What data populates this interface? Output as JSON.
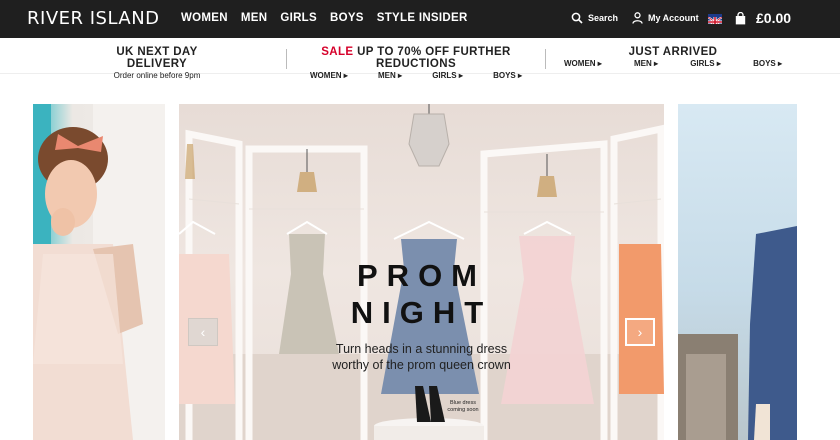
{
  "brand": {
    "logo_text": "RIVER ISLAND"
  },
  "nav": {
    "items": [
      {
        "label": "WOMEN"
      },
      {
        "label": "MEN"
      },
      {
        "label": "GIRLS"
      },
      {
        "label": "BOYS"
      },
      {
        "label": "STYLE INSIDER"
      }
    ]
  },
  "utility": {
    "search_label": "Search",
    "account_label": "My Account",
    "bag_total": "£0.00",
    "search_icon": "search-icon",
    "account_icon": "user-icon",
    "bag_icon": "bag-icon",
    "flag_icon": "uk-flag-icon"
  },
  "promos": {
    "delivery": {
      "title": "UK NEXT DAY DELIVERY",
      "subtitle": "Order online before 9pm"
    },
    "sale": {
      "title_highlight": "SALE",
      "title_rest": " UP TO 70% OFF FURTHER REDUCTIONS",
      "links": [
        "WOMEN ▸",
        "MEN ▸",
        "GIRLS ▸",
        "BOYS ▸"
      ]
    },
    "arrived": {
      "title": "JUST ARRIVED",
      "links": [
        "WOMEN ▸",
        "MEN ▸",
        "GIRLS ▸",
        "BOYS ▸"
      ]
    }
  },
  "hero": {
    "title_line1": "PROM",
    "title_line2": "NIGHT",
    "subtitle_line1": "Turn heads in a stunning dress",
    "subtitle_line2": "worthy of the prom queen crown",
    "note_line1": "Blue dress",
    "note_line2": "coming soon",
    "prev_label": "‹",
    "next_label": "›"
  },
  "colors": {
    "header_bg": "#1f1f1f",
    "sale_red": "#d6002a",
    "hero_bg": "#ece3dd"
  }
}
